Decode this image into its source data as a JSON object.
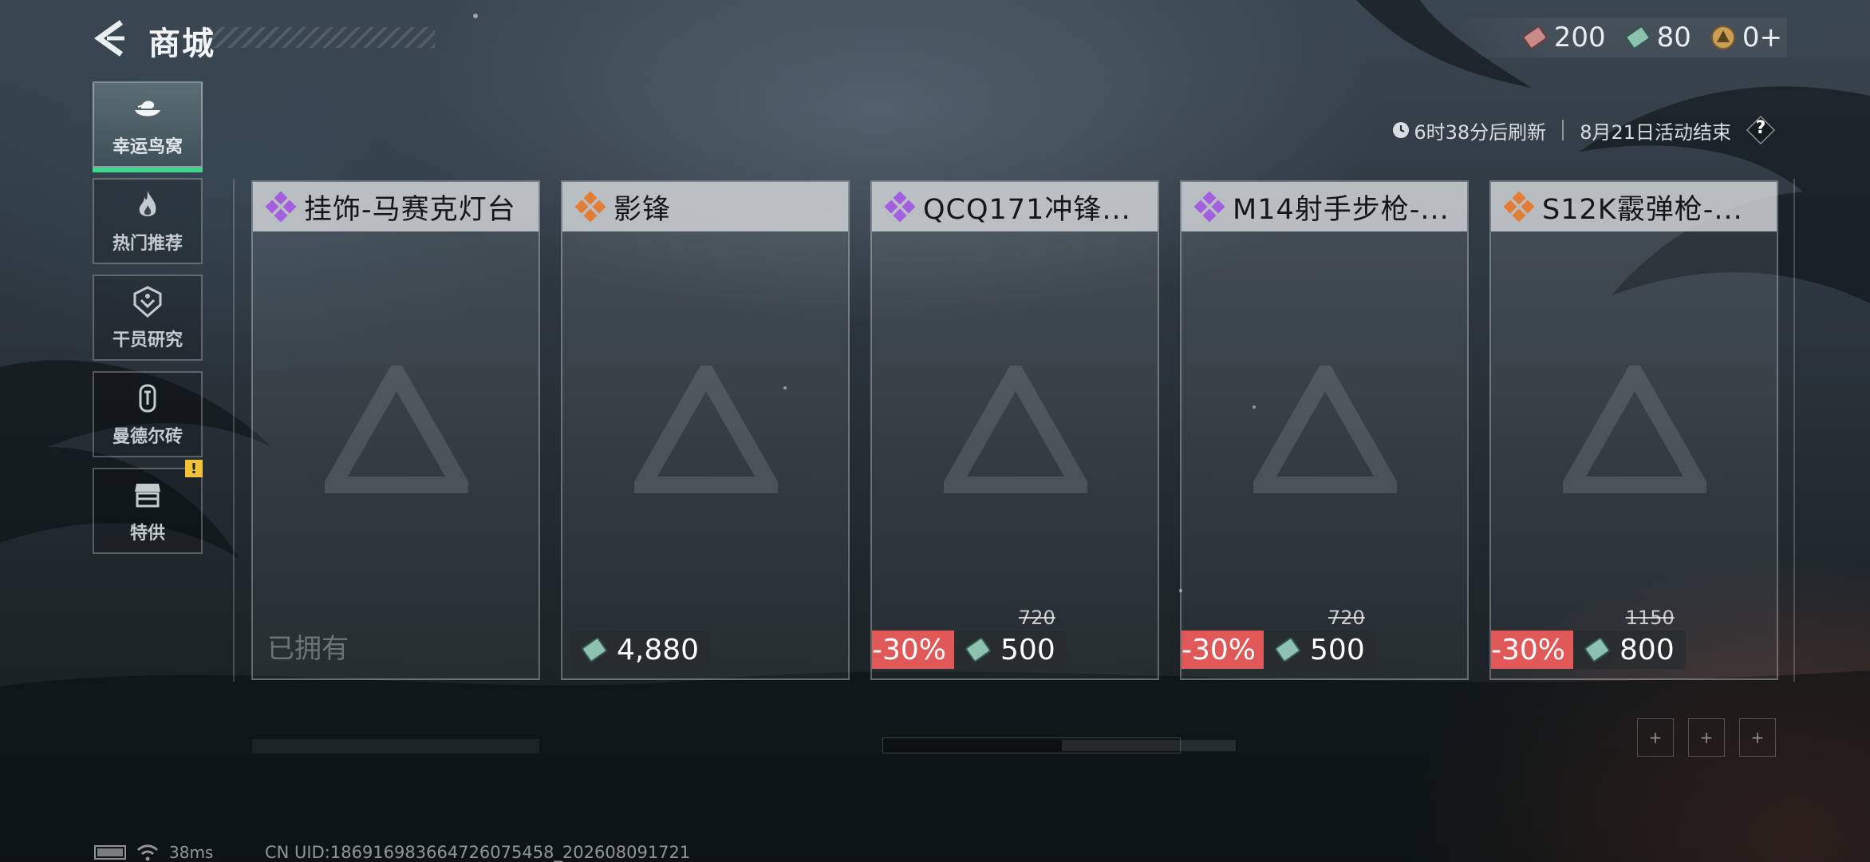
{
  "header": {
    "title": "商城",
    "back_icon": "back-arrow-icon"
  },
  "currencies": [
    {
      "icon": "ticket-red-icon",
      "value": "200"
    },
    {
      "icon": "ticket-green-icon",
      "value": "80"
    },
    {
      "icon": "coin-gold-icon",
      "value": "0+"
    }
  ],
  "refresh": {
    "countdown": "6时38分后刷新",
    "event_end": "8月21日活动结束",
    "help_label": "?"
  },
  "sidebar": {
    "items": [
      {
        "label": "幸运鸟窝",
        "icon": "bird-nest-icon",
        "active": true
      },
      {
        "label": "热门推荐",
        "icon": "flame-icon",
        "active": false
      },
      {
        "label": "干员研究",
        "icon": "operator-research-icon",
        "active": false
      },
      {
        "label": "曼德尔砖",
        "icon": "mandel-brick-icon",
        "active": false
      },
      {
        "label": "特供",
        "icon": "shop-stall-icon",
        "active": false,
        "badge": "!"
      }
    ]
  },
  "cards": [
    {
      "name": "挂饰-马赛克灯台",
      "rarity_color": "#a35fe0",
      "owned_label": "已拥有"
    },
    {
      "name": "影锋",
      "rarity_color": "#e47d34",
      "price": "4,880"
    },
    {
      "name": "QCQ171冲锋...",
      "rarity_color": "#a35fe0",
      "discount": "-30%",
      "original_price": "720",
      "price": "500"
    },
    {
      "name": "M14射手步枪-...",
      "rarity_color": "#a35fe0",
      "discount": "-30%",
      "original_price": "720",
      "price": "500"
    },
    {
      "name": "S12K霰弹枪-...",
      "rarity_color": "#e47d34",
      "discount": "-30%",
      "original_price": "1150",
      "price": "800"
    }
  ],
  "pagination": {
    "buttons": [
      "+",
      "+",
      "+"
    ]
  },
  "status_bar": {
    "ping": "38ms",
    "uid": "CN UID:1869169836647260754​58_202608091721"
  }
}
